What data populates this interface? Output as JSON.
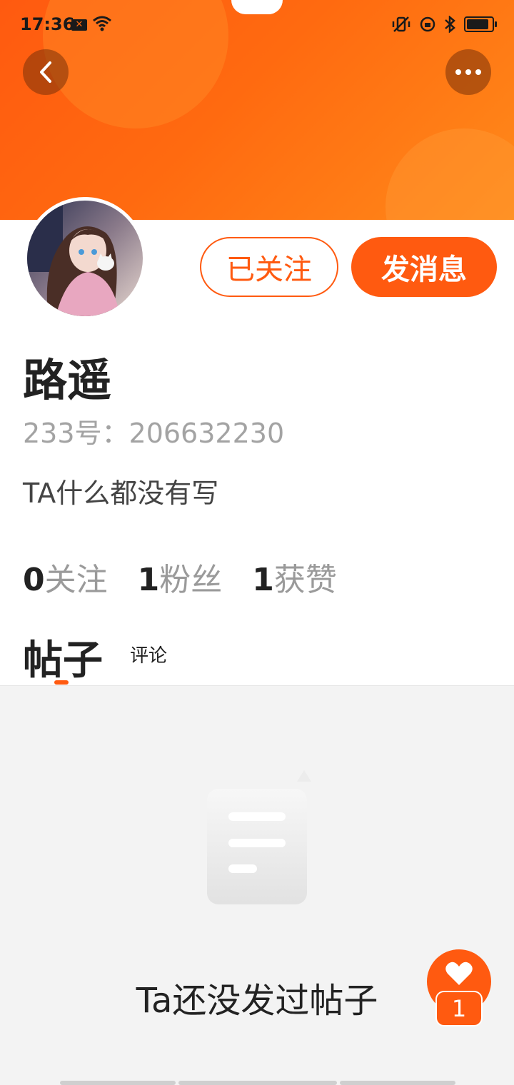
{
  "status_bar": {
    "time": "17:36"
  },
  "header": {
    "back_icon": "chevron-left-icon",
    "more_icon": "more-dots-icon"
  },
  "profile": {
    "follow_button": "已关注",
    "message_button": "发消息",
    "username": "路遥",
    "id_text": "233号：206632230",
    "bio": "TA什么都没有写",
    "stats": [
      {
        "num": "0",
        "label": "关注"
      },
      {
        "num": "1",
        "label": "粉丝"
      },
      {
        "num": "1",
        "label": "获赞"
      }
    ]
  },
  "tabs": {
    "posts": "帖子",
    "comments": "评论"
  },
  "empty_state": {
    "text": "Ta还没发过帖子"
  },
  "floating_like": {
    "count": "1"
  },
  "colors": {
    "accent": "#ff5a10"
  }
}
